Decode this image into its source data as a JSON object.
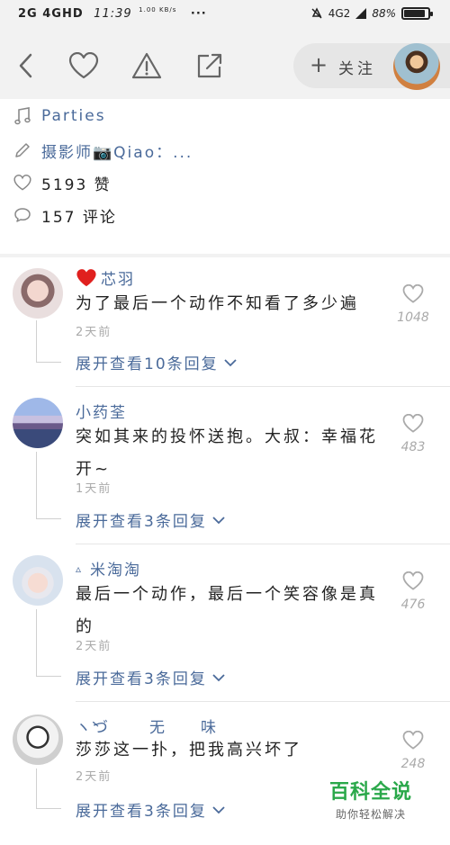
{
  "status_bar": {
    "network1": "2G",
    "network2": "4GHD",
    "time": "11:39",
    "speed": "1.00 KB/s",
    "dots": "···",
    "signal": "4G2",
    "battery_percent": "88%",
    "battery_level": 0.88
  },
  "toolbar": {
    "follow_plus": "+",
    "follow_label": "关注"
  },
  "info": {
    "music": "Parties",
    "author": "摄影师📷Qiao：...",
    "likes": "5193 赞",
    "comments": "157 评论"
  },
  "comments": [
    {
      "name_prefix": "❤️",
      "name": "芯羽",
      "text": "为了最后一个动作不知看了多少遍",
      "time": "2天前",
      "expand": "展开查看10条回复",
      "likes": "1048"
    },
    {
      "name_prefix": "",
      "name": "小药荃",
      "text": "突如其来的投怀送抱。大叔：幸福花开~",
      "time": "1天前",
      "expand": "展开查看3条回复",
      "likes": "483"
    },
    {
      "name_prefix": "▵",
      "name": "米淘淘",
      "text": "最后一个动作，最后一个笑容像是真的",
      "time": "2天前",
      "expand": "展开查看3条回复",
      "likes": "476"
    },
    {
      "name_prefix": "ヽ̀づ",
      "name": "无　　味",
      "text": "莎莎这一扑，把我高兴坏了",
      "time": "2天前",
      "expand": "展开查看3条回复",
      "likes": "248"
    }
  ],
  "watermark": {
    "big": "百科全说",
    "small": "助你轻松解决"
  },
  "colors": {
    "link": "#4a6a9a",
    "watermark": "#2aa84a",
    "heart": "#e0201e"
  }
}
